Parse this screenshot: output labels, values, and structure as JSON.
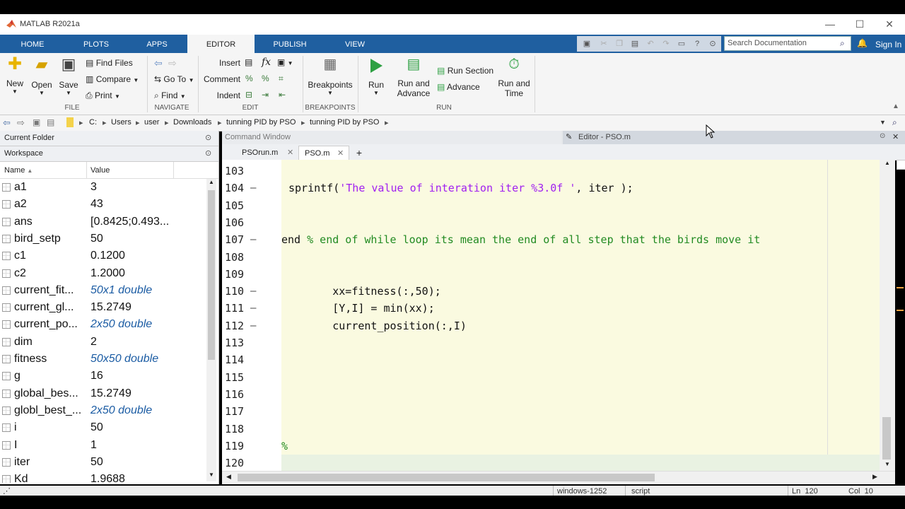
{
  "window": {
    "title": "MATLAB R2021a",
    "minimize": "—",
    "maximize": "☐",
    "close": "✕"
  },
  "tabs": [
    "HOME",
    "PLOTS",
    "APPS",
    "EDITOR",
    "PUBLISH",
    "VIEW"
  ],
  "active_tab": "EDITOR",
  "search": {
    "placeholder": "Search Documentation"
  },
  "signin": "Sign In",
  "toolstrip": {
    "file": {
      "new": "New",
      "open": "Open",
      "save": "Save",
      "find_files": "Find Files",
      "compare": "Compare",
      "print": "Print",
      "group": "FILE"
    },
    "navigate": {
      "goto": "Go To",
      "find": "Find",
      "group": "NAVIGATE"
    },
    "edit": {
      "insert": "Insert",
      "comment": "Comment",
      "indent": "Indent",
      "group": "EDIT"
    },
    "breakpoints": {
      "label": "Breakpoints",
      "group": "BREAKPOINTS"
    },
    "run": {
      "run": "Run",
      "run_advance_1": "Run and",
      "run_advance_2": "Advance",
      "run_section": "Run Section",
      "advance": "Advance",
      "run_time_1": "Run and",
      "run_time_2": "Time",
      "group": "RUN"
    }
  },
  "address": [
    "C:",
    "Users",
    "user",
    "Downloads",
    "tunning PID by PSO",
    "tunning PID by PSO"
  ],
  "current_folder": "Current Folder",
  "workspace": {
    "title": "Workspace",
    "col_name": "Name",
    "col_value": "Value",
    "rows": [
      {
        "name": "a1",
        "value": "3",
        "italic": false
      },
      {
        "name": "a2",
        "value": "43",
        "italic": false
      },
      {
        "name": "ans",
        "value": "[0.8425;0.493...",
        "italic": false
      },
      {
        "name": "bird_setp",
        "value": "50",
        "italic": false
      },
      {
        "name": "c1",
        "value": "0.1200",
        "italic": false
      },
      {
        "name": "c2",
        "value": "1.2000",
        "italic": false
      },
      {
        "name": "current_fit...",
        "value": "50x1 double",
        "italic": true
      },
      {
        "name": "current_gl...",
        "value": "15.2749",
        "italic": false
      },
      {
        "name": "current_po...",
        "value": "2x50 double",
        "italic": true
      },
      {
        "name": "dim",
        "value": "2",
        "italic": false
      },
      {
        "name": "fitness",
        "value": "50x50 double",
        "italic": true
      },
      {
        "name": "g",
        "value": "16",
        "italic": false
      },
      {
        "name": "global_bes...",
        "value": "15.2749",
        "italic": false
      },
      {
        "name": "globl_best_...",
        "value": "2x50 double",
        "italic": true
      },
      {
        "name": "i",
        "value": "50",
        "italic": false
      },
      {
        "name": "I",
        "value": "1",
        "italic": false
      },
      {
        "name": "iter",
        "value": "50",
        "italic": false
      },
      {
        "name": "Kd",
        "value": "1.9688",
        "italic": false
      }
    ]
  },
  "command_window": "Command Window",
  "editor": {
    "title": "Editor - PSO.m",
    "tabs": [
      "PSOrun.m",
      "PSO.m"
    ],
    "add_tab": "+",
    "lines": [
      {
        "n": "103",
        "dash": false,
        "code": ""
      },
      {
        "n": "104",
        "dash": true,
        "code": "sprintf('The value of interation iter %3.0f ', iter );"
      },
      {
        "n": "105",
        "dash": false,
        "code": ""
      },
      {
        "n": "106",
        "dash": false,
        "code": ""
      },
      {
        "n": "107",
        "dash": true,
        "code": "end % end of while loop its mean the end of all step that the birds move it"
      },
      {
        "n": "108",
        "dash": false,
        "code": ""
      },
      {
        "n": "109",
        "dash": false,
        "code": ""
      },
      {
        "n": "110",
        "dash": true,
        "code": "        xx=fitness(:,50);"
      },
      {
        "n": "111",
        "dash": true,
        "code": "        [Y,I] = min(xx);"
      },
      {
        "n": "112",
        "dash": true,
        "code": "        current_position(:,I)"
      },
      {
        "n": "113",
        "dash": false,
        "code": ""
      },
      {
        "n": "114",
        "dash": false,
        "code": ""
      },
      {
        "n": "115",
        "dash": false,
        "code": ""
      },
      {
        "n": "116",
        "dash": false,
        "code": ""
      },
      {
        "n": "117",
        "dash": false,
        "code": ""
      },
      {
        "n": "118",
        "dash": false,
        "code": ""
      },
      {
        "n": "119",
        "dash": false,
        "code": "%"
      },
      {
        "n": "120",
        "dash": false,
        "code": ""
      }
    ]
  },
  "status": {
    "encoding": "windows-1252",
    "type": "script",
    "ln": "Ln  120",
    "col": "Col  10"
  },
  "colors": {
    "tabstrip": "#1f5fa0",
    "string": "#a020f0",
    "comment": "#228b22",
    "code_bg": "#fafae0"
  }
}
